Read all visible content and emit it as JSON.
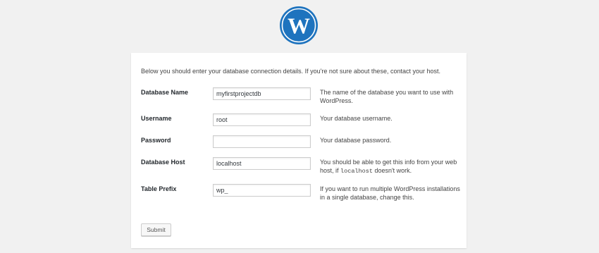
{
  "logo": {
    "icon": "wordpress-logo-icon",
    "color": "#1e73be"
  },
  "intro": "Below you should enter your database connection details. If you're not sure about these, contact your host.",
  "fields": [
    {
      "label": "Database Name",
      "value": "myfirstprojectdb",
      "desc": "The name of the database you want to use with WordPress."
    },
    {
      "label": "Username",
      "value": "root",
      "desc": "Your database username."
    },
    {
      "label": "Password",
      "value": "",
      "desc": "Your database password."
    },
    {
      "label": "Database Host",
      "value": "localhost",
      "desc_before": "You should be able to get this info from your web host, if ",
      "desc_code": "localhost",
      "desc_after": " doesn't work."
    },
    {
      "label": "Table Prefix",
      "value": "wp_",
      "desc": "If you want to run multiple WordPress installations in a single database, change this."
    }
  ],
  "submit_label": "Submit"
}
